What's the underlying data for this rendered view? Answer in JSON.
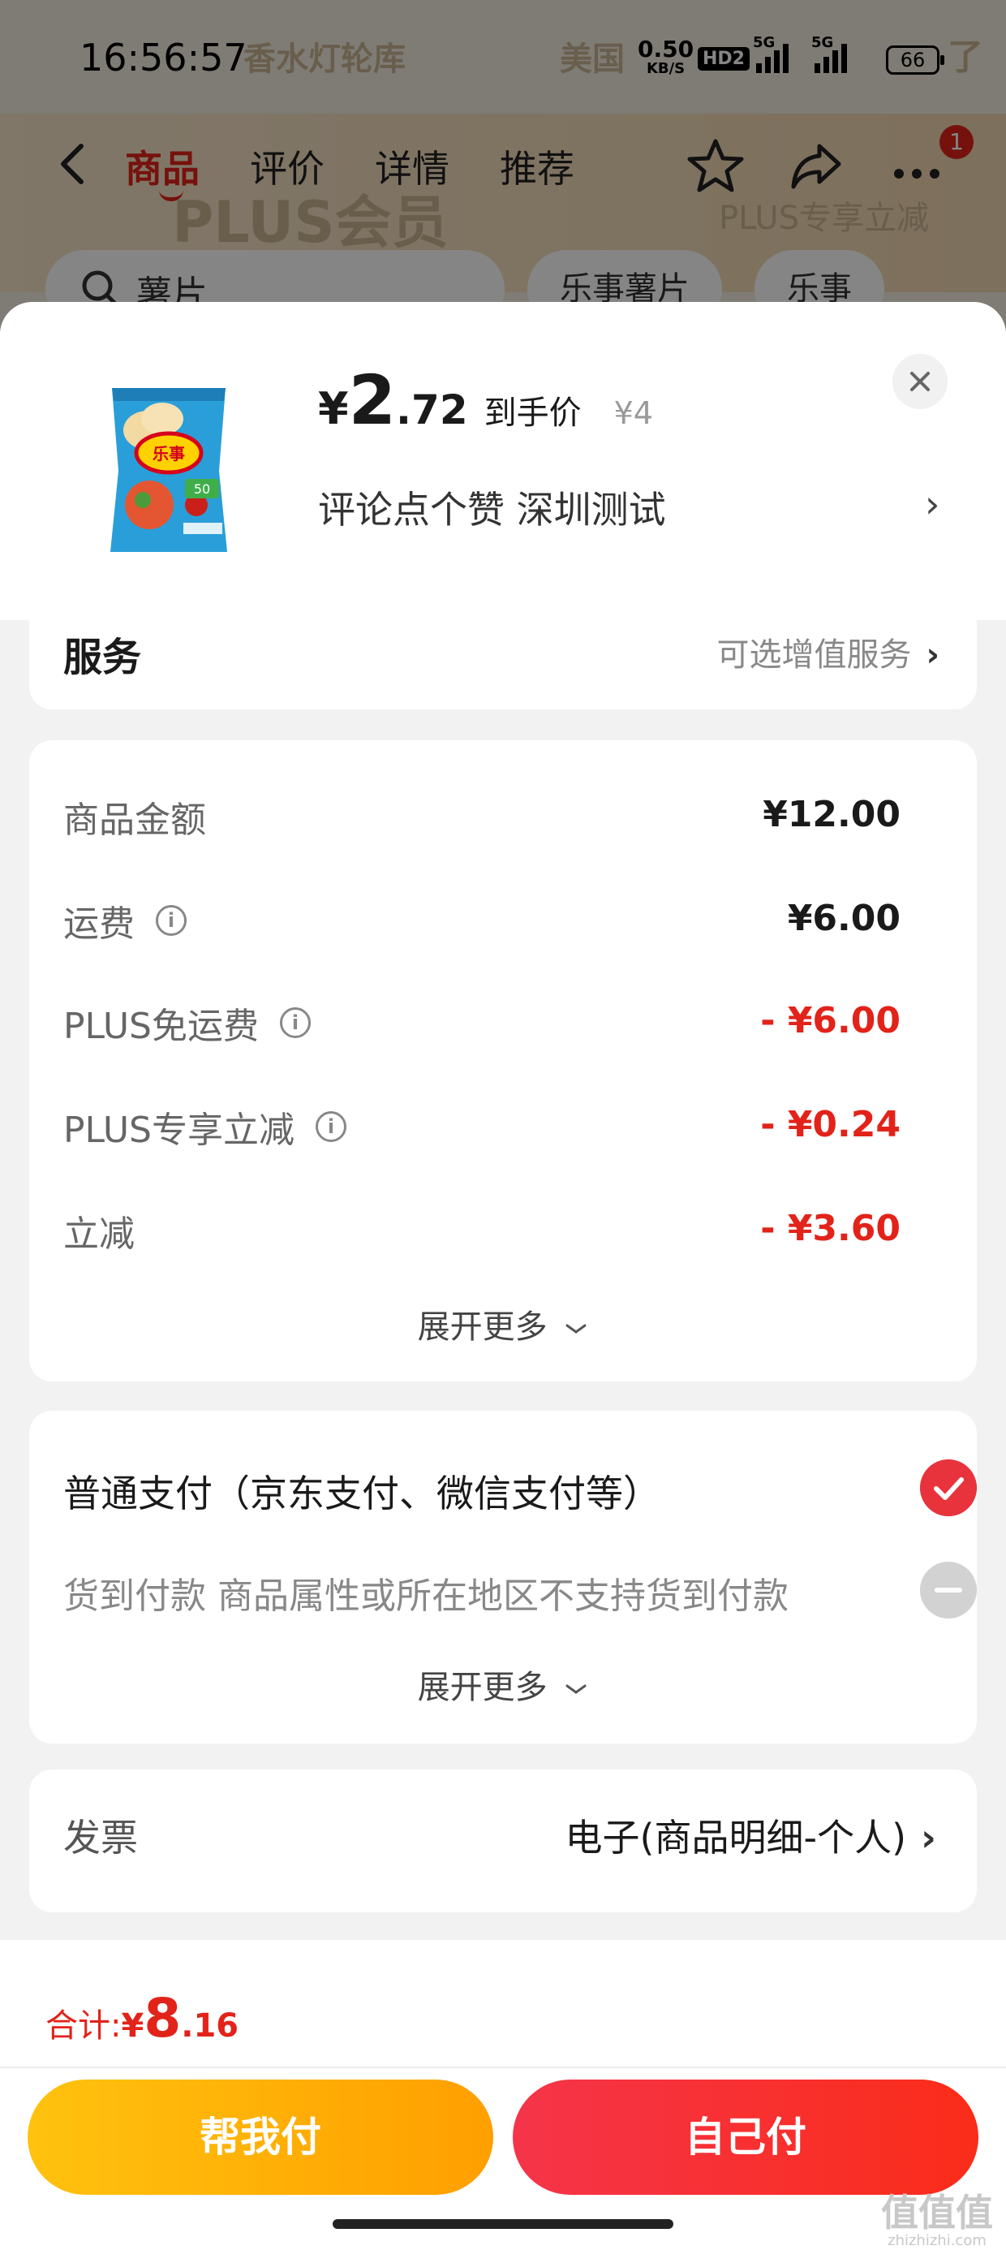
{
  "status_bar": {
    "time": "16:56:57",
    "net_speed": "0.50",
    "net_speed_unit": "KB/S",
    "hd_badge": "HD2",
    "signal1_label": "5G",
    "signal2_label": "5G",
    "battery": "66"
  },
  "background": {
    "ghost_left": "香水灯轮库",
    "ghost_mid": "美国",
    "ghost_right": "了",
    "banner_title": "PLUS会员",
    "banner_right": "PLUS专享立减",
    "search_query": "薯片",
    "chips": [
      "乐事薯片",
      "乐事"
    ]
  },
  "nav": {
    "tabs": [
      "商品",
      "评价",
      "详情",
      "推荐"
    ],
    "active_tab": "商品",
    "badge_count": "1"
  },
  "product": {
    "price_yen": "¥",
    "price_int": "2",
    "price_dec": ".72",
    "price_label": "到手价",
    "original_price": "¥4",
    "subtitle": "评论点个赞  深圳测试",
    "package_brand": "乐事",
    "package_label": "50"
  },
  "service": {
    "title": "服务",
    "right_text": "可选增值服务"
  },
  "fees": {
    "rows": [
      {
        "label": "商品金额",
        "value": "¥12.00",
        "info": false,
        "red": false
      },
      {
        "label": "运费",
        "value": "¥6.00",
        "info": true,
        "red": false
      },
      {
        "label": "PLUS免运费",
        "value": "- ¥6.00",
        "info": true,
        "red": true
      },
      {
        "label": "PLUS专享立减",
        "value": "- ¥0.24",
        "info": true,
        "red": true
      },
      {
        "label": "立减",
        "value": "- ¥3.60",
        "info": false,
        "red": true
      }
    ],
    "expand_label": "展开更多"
  },
  "payment": {
    "normal": "普通支付（京东支付、微信支付等）",
    "cod": "货到付款 商品属性或所在地区不支持货到付款",
    "expand_label": "展开更多"
  },
  "invoice": {
    "label": "发票",
    "value": "电子(商品明细-个人)"
  },
  "bottom": {
    "total_label": "合计: ",
    "total_yen": "¥",
    "total_int": "8",
    "total_dec": ".16",
    "help_pay": "帮我付",
    "self_pay": "自己付"
  },
  "watermark": {
    "text": "值值值",
    "site": "zhizhizhi.com"
  },
  "colors": {
    "accent_red": "#e2231a",
    "help_btn": "#ffb300",
    "self_btn": "#f5344a"
  }
}
